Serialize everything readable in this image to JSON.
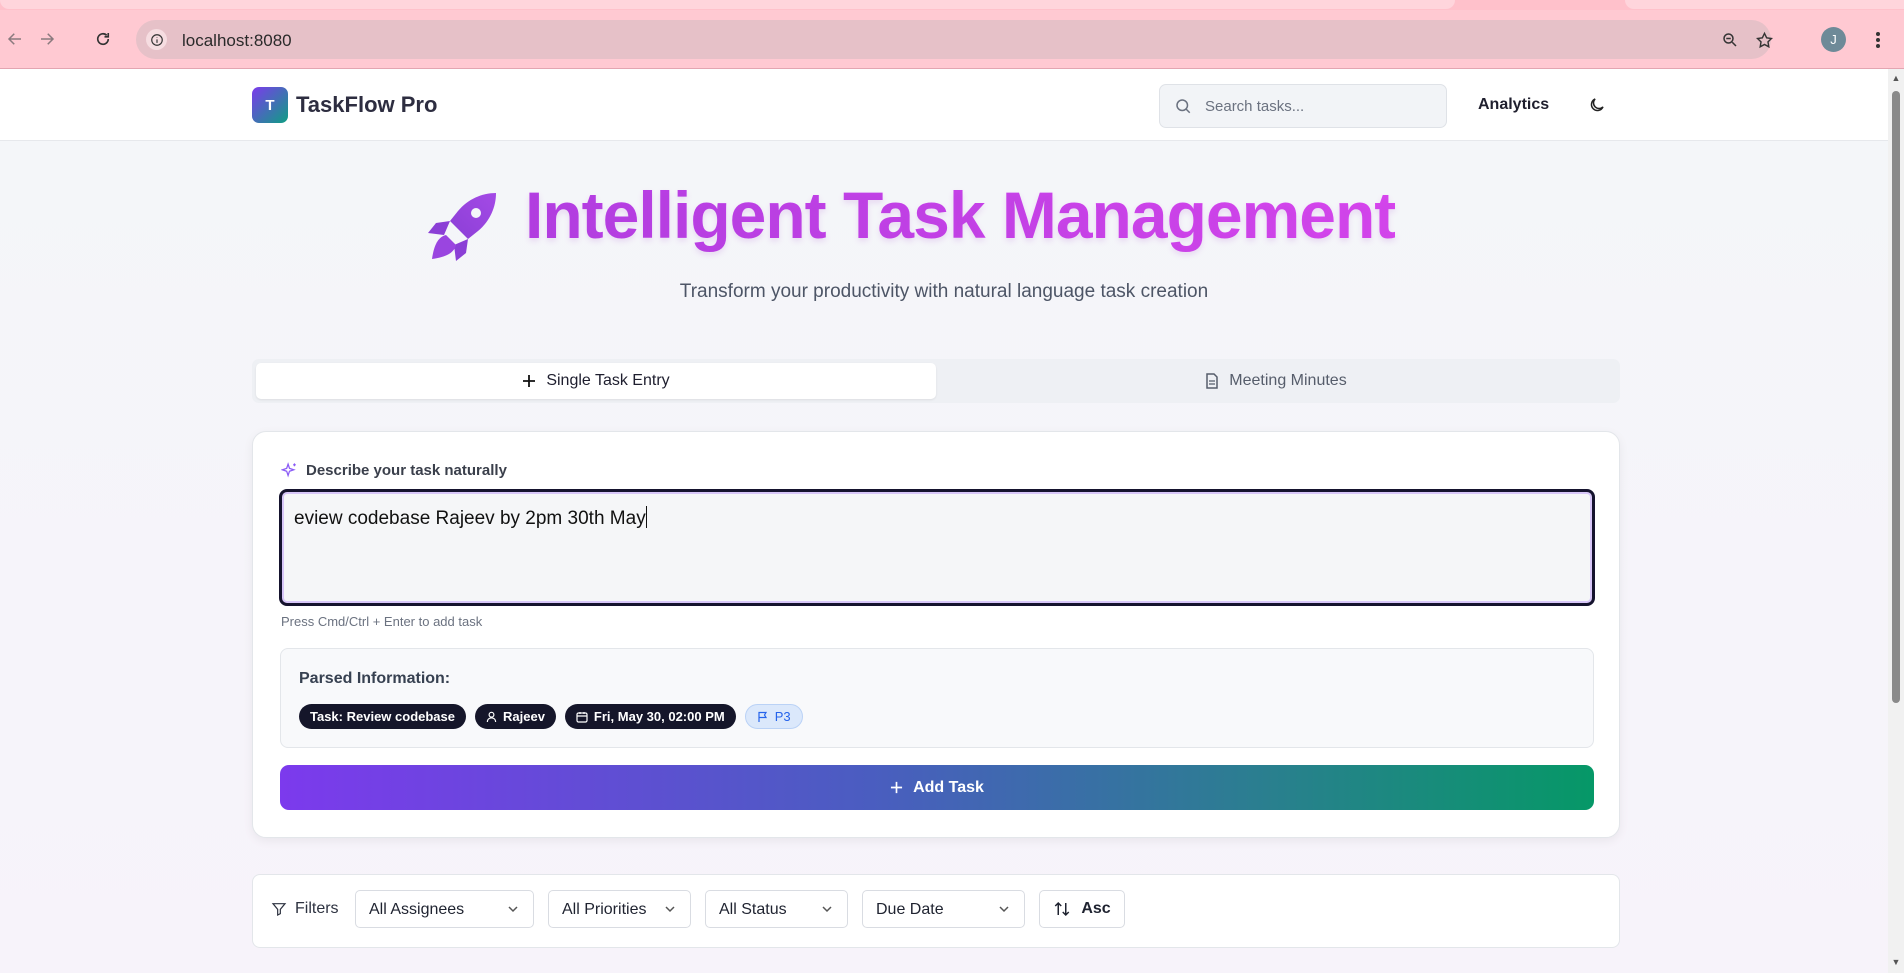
{
  "browser": {
    "url": "localhost:8080",
    "profile_initial": "J"
  },
  "header": {
    "logo_letter": "T",
    "brand": "TaskFlow Pro",
    "search_placeholder": "Search tasks...",
    "analytics_label": "Analytics"
  },
  "hero": {
    "title": "Intelligent Task Management",
    "subtitle": "Transform your productivity with natural language task creation"
  },
  "tabs": [
    {
      "label": "Single Task Entry",
      "icon": "plus-icon",
      "active": true
    },
    {
      "label": "Meeting Minutes",
      "icon": "document-icon",
      "active": false
    }
  ],
  "task_entry": {
    "label": "Describe your task naturally",
    "value": "eview codebase Rajeev by 2pm 30th May",
    "hint": "Press Cmd/Ctrl + Enter to add task",
    "parsed_title": "Parsed Information:",
    "chips": {
      "task": "Task: Review codebase",
      "assignee": "Rajeev",
      "due": "Fri, May 30, 02:00 PM",
      "priority": "P3"
    },
    "add_label": "Add Task"
  },
  "filters": {
    "label": "Filters",
    "assignee": "All Assignees",
    "priority": "All Priorities",
    "status": "All Status",
    "sort_field": "Due Date",
    "sort_order": "Asc"
  },
  "colors": {
    "accent_purple": "#7c3aed",
    "accent_green": "#069867",
    "hero_magenta": "#c23be8"
  }
}
